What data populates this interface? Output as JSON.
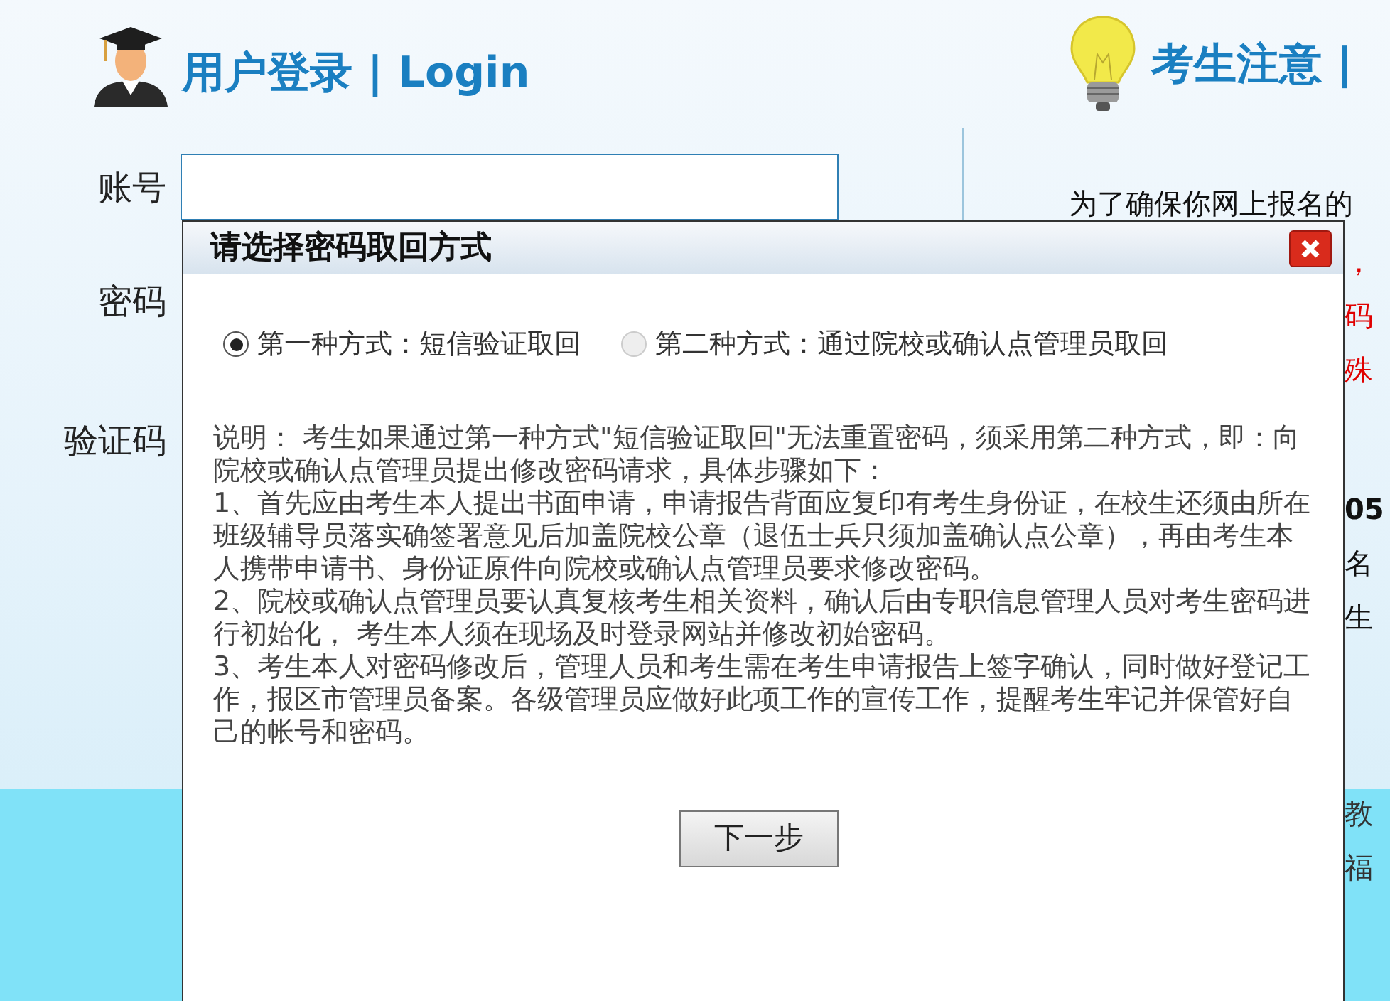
{
  "login": {
    "heading": "用户登录 | Login",
    "fields": [
      {
        "label": "账号"
      },
      {
        "label": "密码"
      },
      {
        "label": "验证码"
      }
    ]
  },
  "notice": {
    "heading": "考生注意 |",
    "intro": "为了确保你网上报名的",
    "fragments": [
      {
        "text": "，",
        "color": "#e00000"
      },
      {
        "text": "码",
        "color": "#e00000"
      },
      {
        "text": "殊",
        "color": "#e00000"
      },
      {
        "text": "05",
        "color": "#111111"
      },
      {
        "text": "名",
        "color": "#111111"
      },
      {
        "text": "生",
        "color": "#111111"
      },
      {
        "text": "教",
        "color": "#333333"
      },
      {
        "text": "福",
        "color": "#333333"
      }
    ]
  },
  "dialog": {
    "title": "请选择密码取回方式",
    "options": [
      {
        "label": "第一种方式：短信验证取回",
        "selected": true
      },
      {
        "label": "第二种方式：通过院校或确认点管理员取回",
        "selected": false
      }
    ],
    "paragraphs": [
      "说明： 考生如果通过第一种方式\"短信验证取回\"无法重置密码，须采用第二种方式，即：向院校或确认点管理员提出修改密码请求，具体步骤如下：",
      "1、首先应由考生本人提出书面申请，申请报告背面应复印有考生身份证，在校生还须由所在班级辅导员落实确签署意见后加盖院校公章（退伍士兵只须加盖确认点公章），再由考生本人携带申请书、身份证原件向院校或确认点管理员要求修改密码。",
      "2、院校或确认点管理员要认真复核考生相关资料，确认后由专职信息管理人员对考生密码进行初始化， 考生本人须在现场及时登录网站并修改初始密码。",
      "3、考生本人对密码修改后，管理人员和考生需在考生申请报告上签字确认，同时做好登记工作，报区市管理员备案。各级管理员应做好此项工作的宣传工作，提醒考生牢记并保管好自己的帐号和密码。"
    ],
    "next_button": "下一步"
  }
}
